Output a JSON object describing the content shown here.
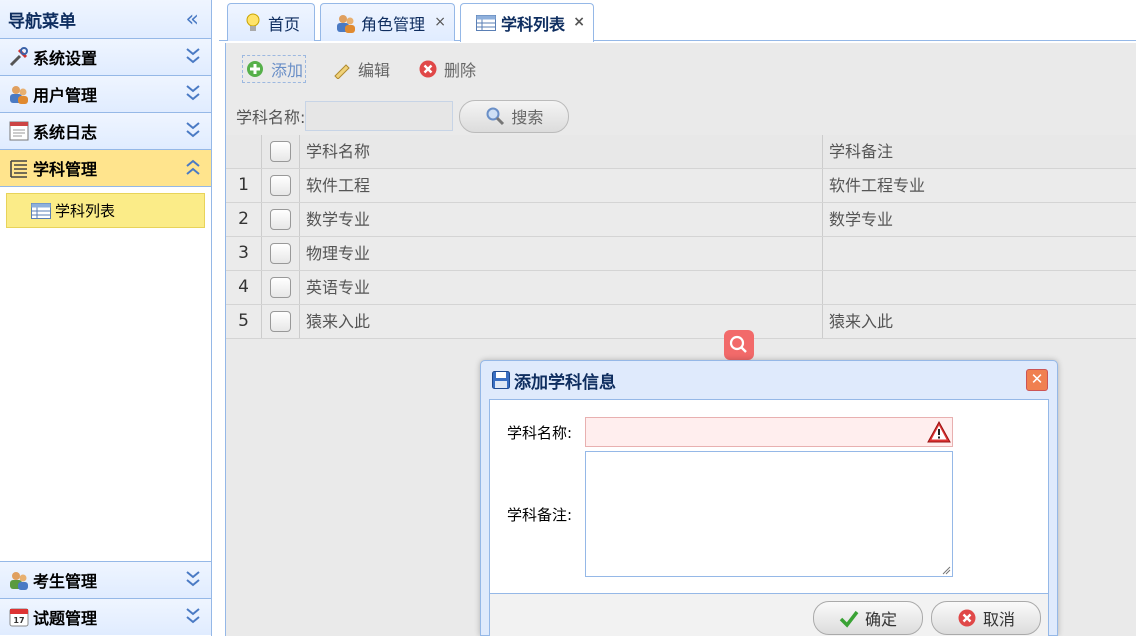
{
  "nav": {
    "title": "导航菜单",
    "panels": [
      {
        "label": "系统设置"
      },
      {
        "label": "用户管理"
      },
      {
        "label": "系统日志"
      },
      {
        "label": "学科管理"
      }
    ],
    "sub_item": "学科列表",
    "bottom_panels": [
      {
        "label": "考生管理"
      },
      {
        "label": "试题管理"
      }
    ]
  },
  "tabs": [
    {
      "label": "首页"
    },
    {
      "label": "角色管理",
      "close": "×"
    },
    {
      "label": "学科列表",
      "close": "×"
    }
  ],
  "toolbar": {
    "add": "添加",
    "edit": "编辑",
    "delete": "删除"
  },
  "search": {
    "label": "学科名称:",
    "value": "",
    "button": "搜索"
  },
  "grid": {
    "columns": [
      "学科名称",
      "学科备注"
    ],
    "rows": [
      {
        "num": "1",
        "name": "软件工程",
        "note": "软件工程专业"
      },
      {
        "num": "2",
        "name": "数学专业",
        "note": "数学专业"
      },
      {
        "num": "3",
        "name": "物理专业",
        "note": ""
      },
      {
        "num": "4",
        "name": "英语专业",
        "note": ""
      },
      {
        "num": "5",
        "name": "猿来入此",
        "note": "猿来入此"
      }
    ]
  },
  "dialog": {
    "title": "添加学科信息",
    "name_label": "学科名称:",
    "note_label": "学科备注:",
    "name_value": "",
    "note_value": "",
    "ok": "确定",
    "cancel": "取消"
  },
  "colors": {
    "accent": "#95b8e7",
    "active_panel": "#ffe48d",
    "selected_item": "#fbec88"
  }
}
